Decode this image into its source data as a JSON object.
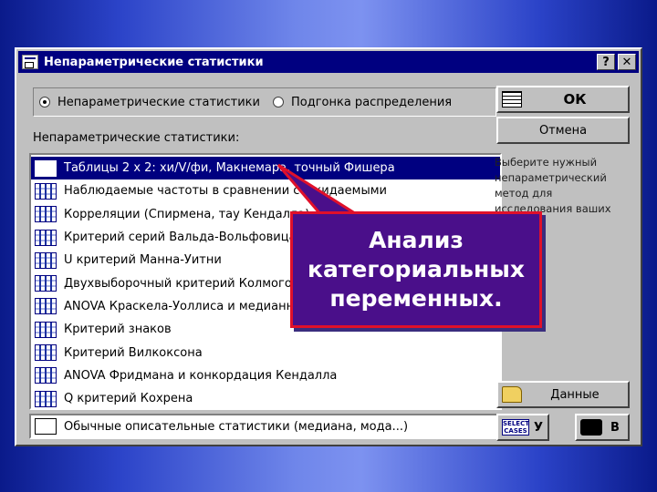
{
  "window": {
    "title": "Непараметрические статистики",
    "help_btn": "?",
    "close_btn": "✕"
  },
  "mode": {
    "option1": "Непараметрические статистики",
    "option2": "Подгонка распределения",
    "selected": "option1"
  },
  "list": {
    "label": "Непараметрические статистики:",
    "items": [
      "Таблицы 2 х 2:  хи/V/фи, Макнемара, точный Фишера",
      "Наблюдаемые частоты в сравнении с ожидаемыми",
      "Корреляции (Спирмена, тау Кендалла)",
      "Критерий серий Вальда-Вольфовица",
      "U критерий Манна-Уитни",
      "Двухвыборочный критерий Колмогорова-Смирнова",
      "ANOVA Краскела-Уоллиса и медианный тест",
      "Критерий знаков",
      "Критерий Вилкоксона",
      "ANOVA Фридмана и конкордация Кендалла",
      "Q критерий Кохрена"
    ],
    "selected_index": 0
  },
  "descriptive": {
    "label": "Обычные описательные статистики (медиана, мода...)"
  },
  "buttons": {
    "ok": "ОК",
    "cancel": "Отмена",
    "data": "Данные",
    "select_cases_icon": "SELECT CASES",
    "select_key": "У",
    "print_key": "В"
  },
  "help_text": "Выберите нужный непараметрический метод для исследования ваших",
  "callout": {
    "text": "Анализ категориальных переменных."
  },
  "colors": {
    "titlebar": "#000080",
    "callout_fill": "#4a0f8a",
    "callout_border": "#e0102a"
  }
}
